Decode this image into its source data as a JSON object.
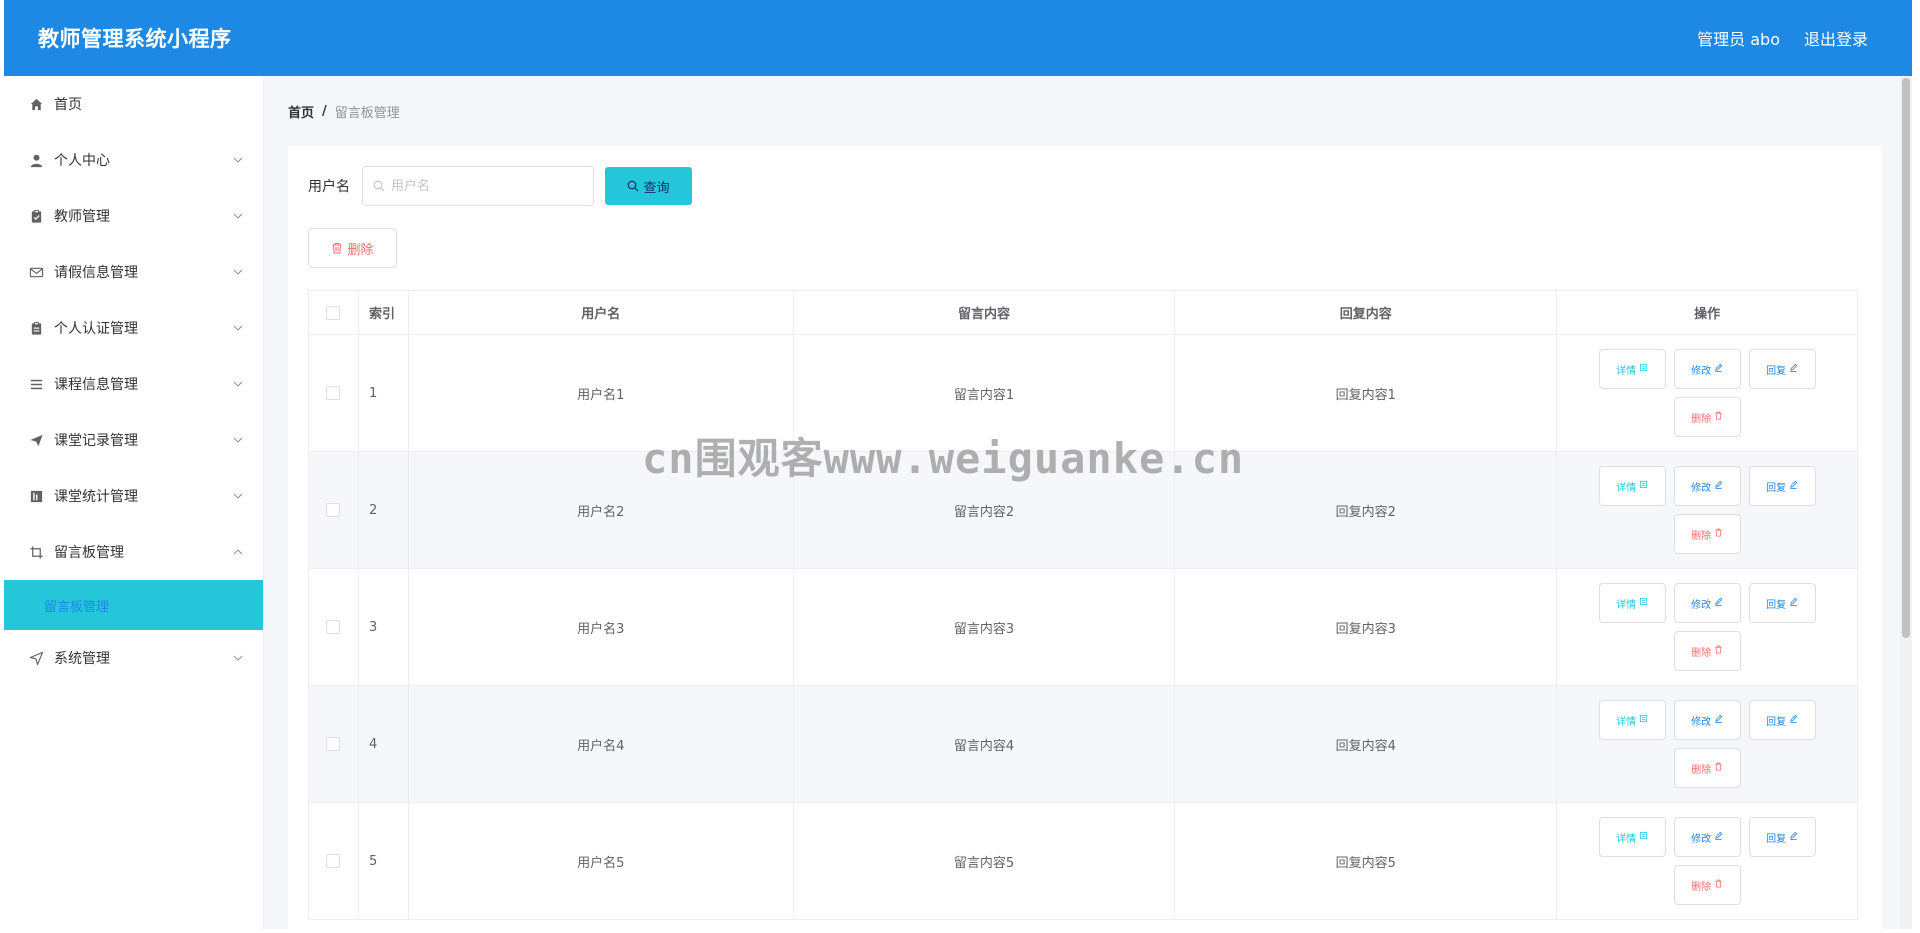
{
  "header": {
    "title": "教师管理系统小程序",
    "user_label": "管理员 abo",
    "logout_label": "退出登录",
    "bg_color": "#1e88e5"
  },
  "sidebar": {
    "items": [
      {
        "label": "首页",
        "icon": "home-icon"
      },
      {
        "label": "个人中心",
        "icon": "user-icon"
      },
      {
        "label": "教师管理",
        "icon": "clipboard-icon"
      },
      {
        "label": "请假信息管理",
        "icon": "mail-icon"
      },
      {
        "label": "个人认证管理",
        "icon": "id-card-icon"
      },
      {
        "label": "课程信息管理",
        "icon": "list-icon"
      },
      {
        "label": "课堂记录管理",
        "icon": "send-icon"
      },
      {
        "label": "课堂统计管理",
        "icon": "chart-icon"
      },
      {
        "label": "留言板管理",
        "icon": "crop-icon"
      },
      {
        "label": "系统管理",
        "icon": "navigation-icon"
      }
    ],
    "active_submenu": "留言板管理",
    "accent_color": "#26c6da"
  },
  "breadcrumb": {
    "home": "首页",
    "separator": "/",
    "current": "留言板管理"
  },
  "search": {
    "label": "用户名",
    "placeholder": "用户名",
    "query_label": "查询"
  },
  "toolbar": {
    "delete_label": "删除"
  },
  "table": {
    "headers": [
      "索引",
      "用户名",
      "留言内容",
      "回复内容",
      "操作"
    ],
    "rows": [
      {
        "index": "1",
        "username": "用户名1",
        "message": "留言内容1",
        "reply": "回复内容1"
      },
      {
        "index": "2",
        "username": "用户名2",
        "message": "留言内容2",
        "reply": "回复内容2"
      },
      {
        "index": "3",
        "username": "用户名3",
        "message": "留言内容3",
        "reply": "回复内容3"
      },
      {
        "index": "4",
        "username": "用户名4",
        "message": "留言内容4",
        "reply": "回复内容4"
      },
      {
        "index": "5",
        "username": "用户名5",
        "message": "留言内容5",
        "reply": "回复内容5"
      }
    ],
    "ops": {
      "detail": "详情",
      "edit": "修改",
      "reply": "回复",
      "delete": "删除"
    }
  },
  "watermark": "cn围观客www.weiguanke.cn"
}
